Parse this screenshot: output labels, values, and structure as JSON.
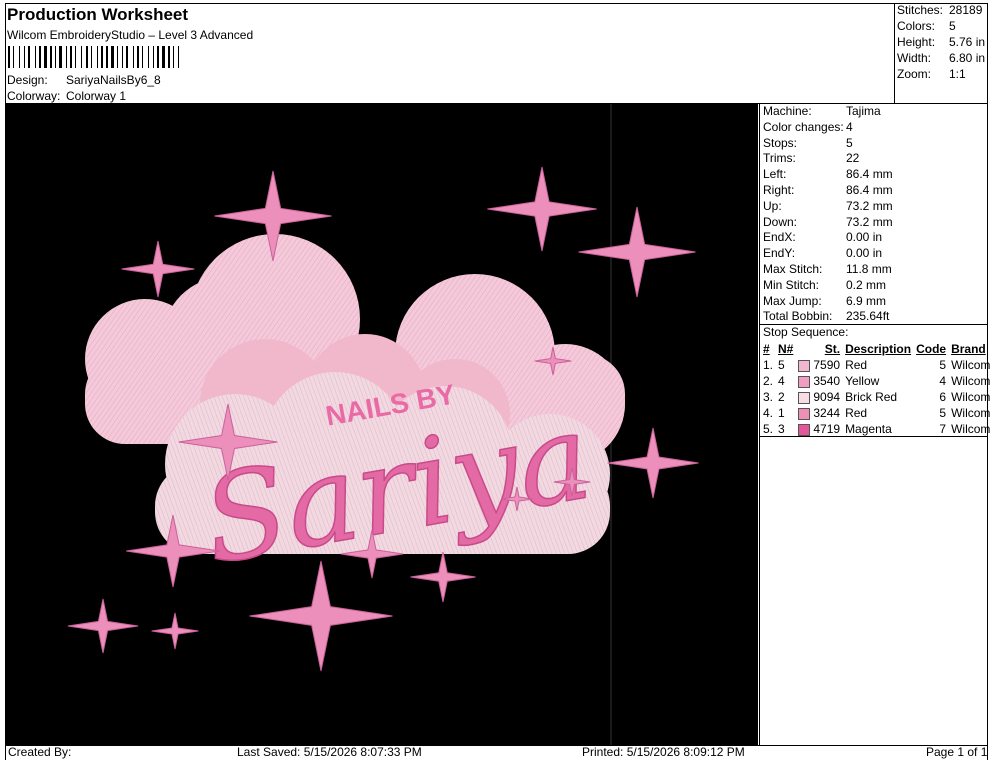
{
  "header": {
    "title": "Production Worksheet",
    "software": "Wilcom EmbroideryStudio – Level 3 Advanced",
    "design_label": "Design:",
    "design_value": "SariyaNailsBy6_8",
    "colorway_label": "Colorway:",
    "colorway_value": "Colorway 1"
  },
  "summary": [
    {
      "label": "Stitches:",
      "value": "28189"
    },
    {
      "label": "Colors:",
      "value": "5"
    },
    {
      "label": "Height:",
      "value": "5.76 in"
    },
    {
      "label": "Width:",
      "value": "6.80 in"
    },
    {
      "label": "Zoom:",
      "value": "1:1"
    }
  ],
  "machine_info": [
    {
      "label": "Machine:",
      "value": "Tajima"
    },
    {
      "label": "Color changes:",
      "value": "4"
    },
    {
      "label": "Stops:",
      "value": "5"
    },
    {
      "label": "Trims:",
      "value": "22"
    },
    {
      "label": "Left:",
      "value": "86.4 mm"
    },
    {
      "label": "Right:",
      "value": "86.4 mm"
    },
    {
      "label": "Up:",
      "value": "73.2 mm"
    },
    {
      "label": "Down:",
      "value": "73.2 mm"
    },
    {
      "label": "EndX:",
      "value": "0.00 in"
    },
    {
      "label": "EndY:",
      "value": "0.00 in"
    },
    {
      "label": "Max Stitch:",
      "value": "11.8 mm"
    },
    {
      "label": "Min Stitch:",
      "value": "0.2 mm"
    },
    {
      "label": "Max Jump:",
      "value": "6.9 mm"
    },
    {
      "label": "Total Bobbin:",
      "value": "235.64ft"
    }
  ],
  "stop_sequence": {
    "title": "Stop Sequence:",
    "headers": {
      "num": "#",
      "n": "N#",
      "st": "St.",
      "description": "Description",
      "code": "Code",
      "brand": "Brand"
    },
    "rows": [
      {
        "num": "1.",
        "n": "5",
        "color": "#f4b6cf",
        "st": "7590",
        "description": "Red",
        "code": "5",
        "brand": "Wilcom"
      },
      {
        "num": "2.",
        "n": "4",
        "color": "#f39cc1",
        "st": "3540",
        "description": "Yellow",
        "code": "4",
        "brand": "Wilcom"
      },
      {
        "num": "3.",
        "n": "2",
        "color": "#f7dde6",
        "st": "9094",
        "description": "Brick Red",
        "code": "6",
        "brand": "Wilcom"
      },
      {
        "num": "4.",
        "n": "1",
        "color": "#ee8fb8",
        "st": "3244",
        "description": "Red",
        "code": "5",
        "brand": "Wilcom"
      },
      {
        "num": "5.",
        "n": "3",
        "color": "#e4559a",
        "st": "4719",
        "description": "Magenta",
        "code": "7",
        "brand": "Wilcom"
      }
    ]
  },
  "design_text": {
    "small": "NAILS BY",
    "big": "Sariya"
  },
  "footer": {
    "created_by": "Created By:",
    "last_saved": "Last Saved: 5/15/2026 8:07:33 PM",
    "printed": "Printed: 5/15/2026 8:09:12 PM",
    "page": "Page 1 of 1"
  }
}
